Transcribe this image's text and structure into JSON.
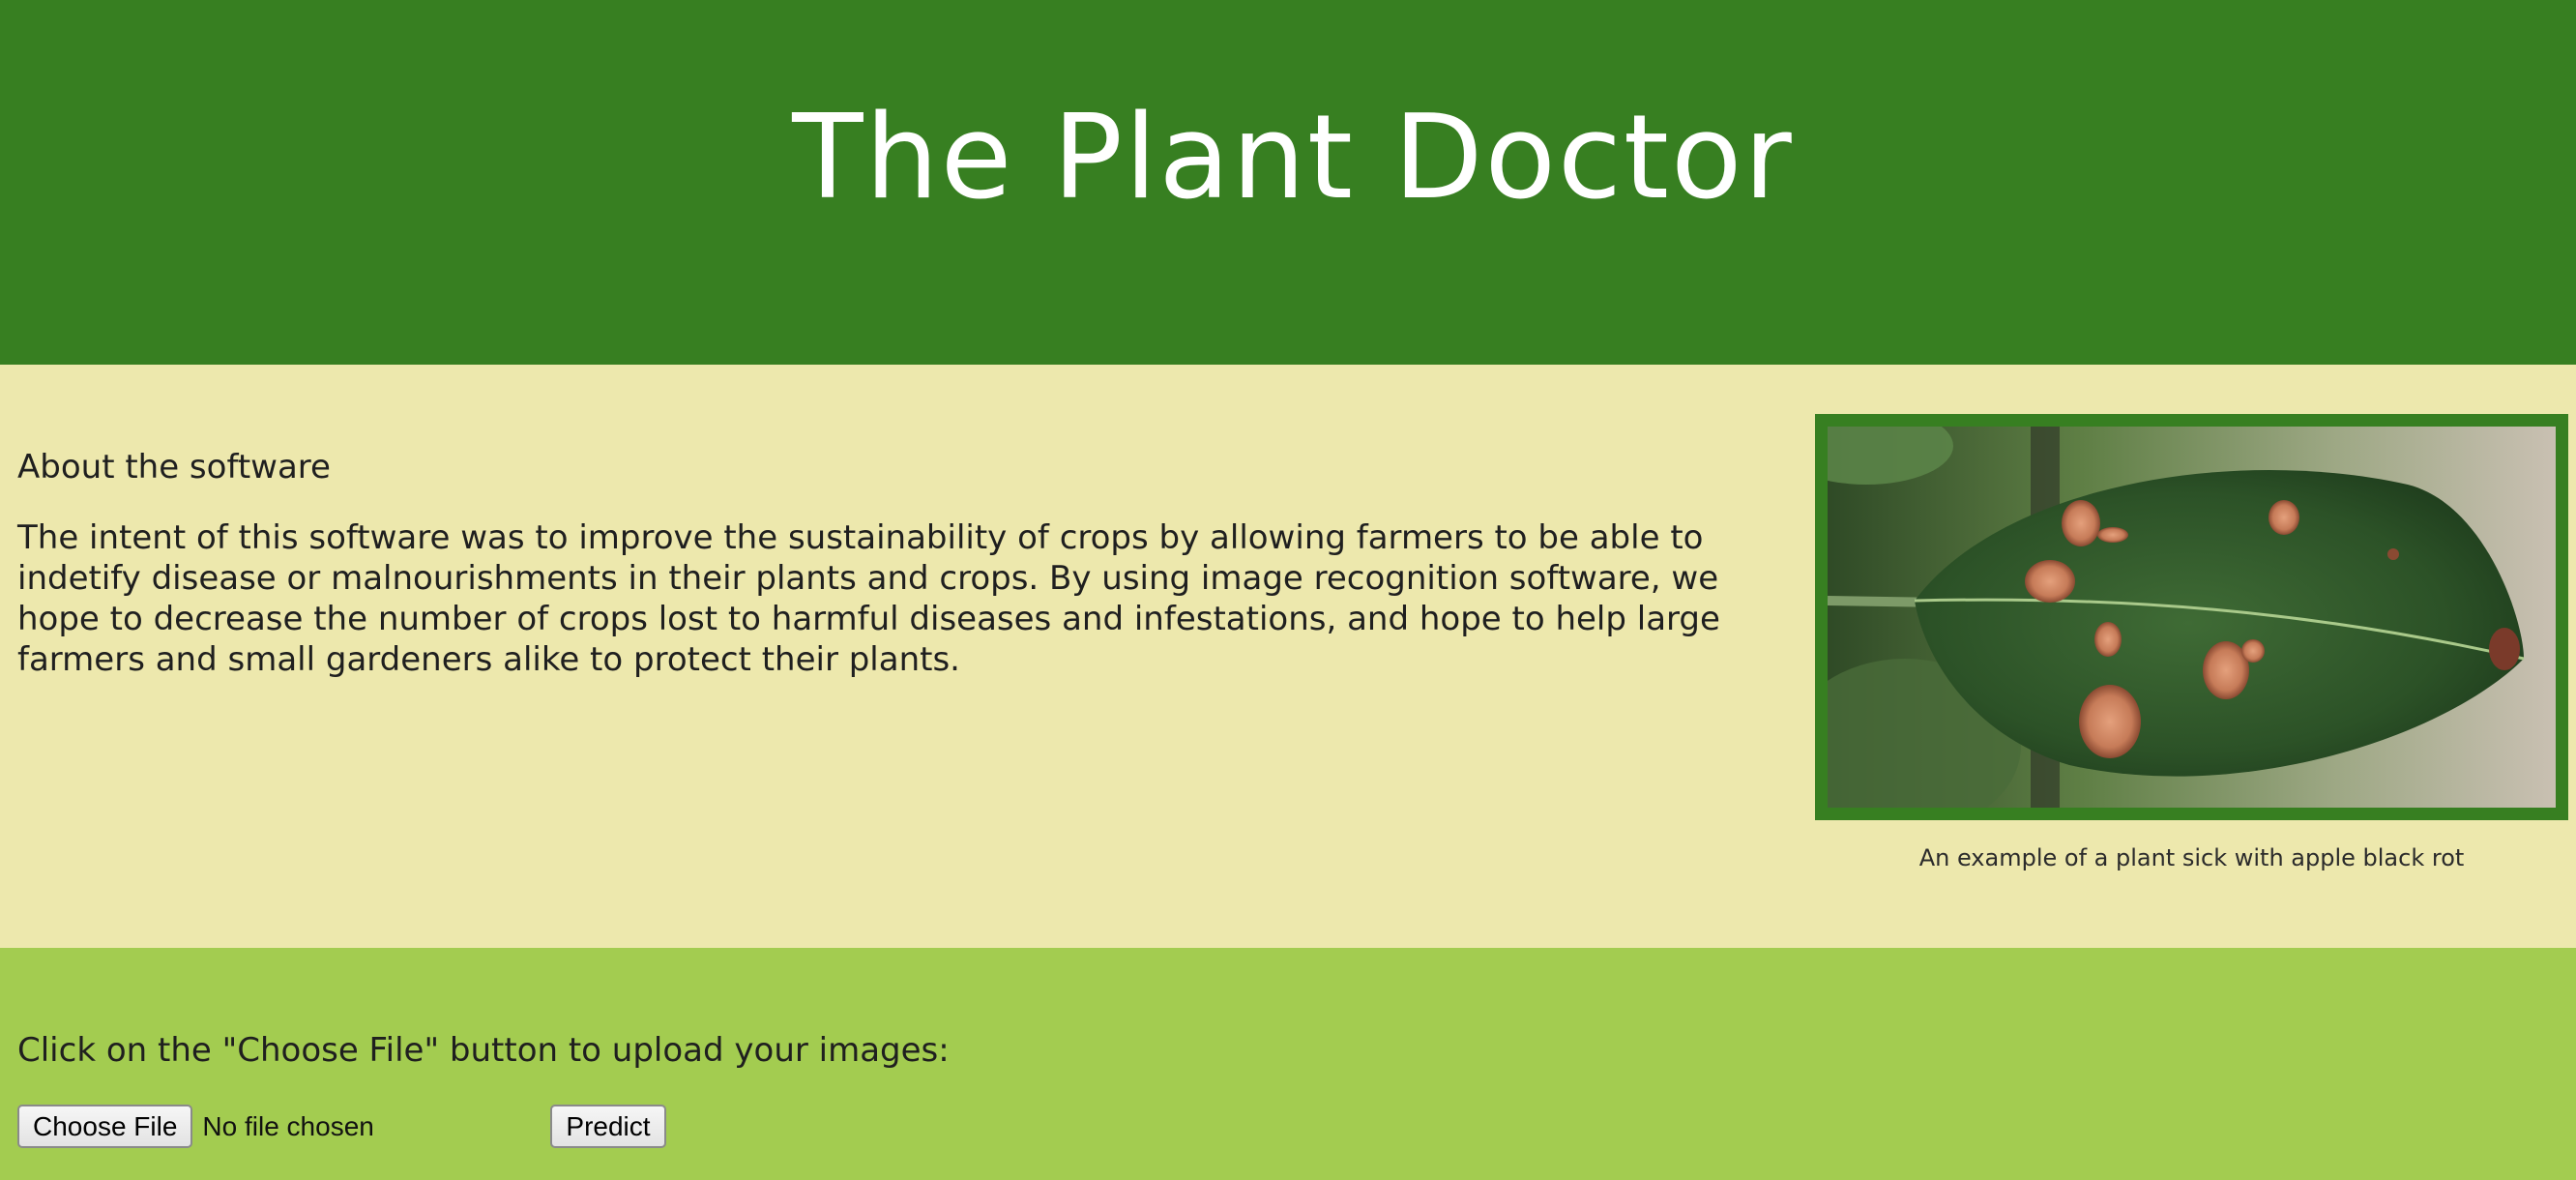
{
  "header": {
    "title": "The Plant Doctor"
  },
  "about": {
    "heading": "About the software",
    "text": "The intent of this software was to improve the sustainability of crops by allowing farmers to be able to indetify disease or malnourishments in their plants and crops. By using image recognition software, we hope to decrease the number of crops lost to harmful diseases and infestations, and hope to help large farmers and small gardeners alike to protect their plants.",
    "image_caption": "An example of a plant sick with apple black rot"
  },
  "upload": {
    "instructions": "Click on the \"Choose File\" button to upload your images:",
    "choose_file_label": "Choose File",
    "file_status": "No file chosen",
    "predict_label": "Predict"
  },
  "colors": {
    "header_bg": "#377f21",
    "about_bg": "#ede8ad",
    "upload_bg": "#a3cc50"
  }
}
